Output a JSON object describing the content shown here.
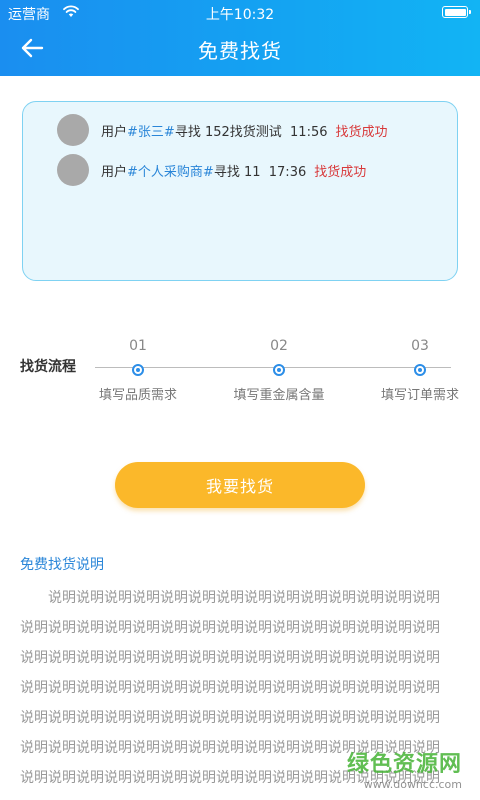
{
  "status": {
    "carrier": "运营商",
    "time": "上午10:32"
  },
  "header": {
    "title": "免费找货"
  },
  "ticker": [
    {
      "prefix": "用户",
      "name": "#张三#",
      "middle": "寻找 152找货测试",
      "time": "11:56",
      "status": "找货成功"
    },
    {
      "prefix": "用户",
      "name": "#个人采购商#",
      "middle": "寻找 11",
      "time": "17:36",
      "status": "找货成功"
    }
  ],
  "flow": {
    "label": "找货流程",
    "steps": [
      {
        "num": "01",
        "text": "填写品质需求"
      },
      {
        "num": "02",
        "text": "填写重金属含量"
      },
      {
        "num": "03",
        "text": "填写订单需求"
      }
    ]
  },
  "find_button": "我要找货",
  "description": {
    "title": "免费找货说明",
    "body": "说明说明说明说明说明说明说明说明说明说明说明说明说明说明说明说明说明说明说明说明说明说明说明说明说明说明说明说明说明说明说明说明说明说明说明说明说明说明说明说明说明说明说明说明说明说明说明说明说明说明说明说明说明说明说明说明说明说明说明说明说明说明说明说明说明说明说明说明说明说明说明说明说明说明说明说明说明说明说明说明说明说明说明说明说明说明说明说明说明说明说明说明说明说明说明说明说明说明说明说明说明说明说明说明说明说明说明说明说明说明说明说明说明说明说明说明说明说明说明说明说明说明说明说明说明说明说明说明说明说明说明说明说明说明说明说明说明说明说明说明说明说明说明说明说明说明说明说明说明说明说明说明说明说明说明说明说明说明说明说明说明说明说明说明说明说明说明说明说明说明说明说明说明说明说明说明说明说明说明说明说明说明说明说明说明说明说明说明说明"
  },
  "watermark": {
    "main": "绿色资源网",
    "sub": "www.downcc.com"
  },
  "colors": {
    "header_start": "#1a8ef0",
    "header_end": "#12b4f4",
    "accent_blue": "#2a86d8",
    "success_red": "#d8393a",
    "button_orange": "#fbb82a",
    "ticker_bg": "#e8f7fd"
  }
}
